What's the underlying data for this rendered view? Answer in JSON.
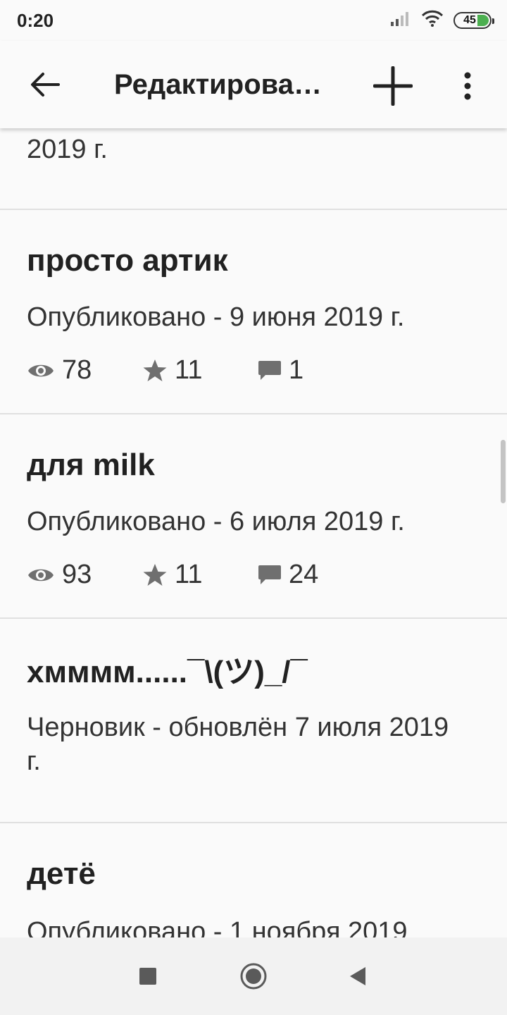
{
  "status_bar": {
    "time": "0:20",
    "battery": "45"
  },
  "app_bar": {
    "title": "Редактирова…"
  },
  "posts": [
    {
      "status": "2019 г."
    },
    {
      "title": "просто артик",
      "status": "Опубликовано - 9 июня 2019 г.",
      "views": "78",
      "stars": "11",
      "comments": "1"
    },
    {
      "title": "для milk",
      "status": "Опубликовано - 6 июля 2019 г.",
      "views": "93",
      "stars": "11",
      "comments": "24"
    },
    {
      "title": "хмммм......¯\\(ツ)_/¯",
      "status": "Черновик - обновлён 7 июля 2019 г."
    },
    {
      "title": "детё",
      "status": "Опубликовано - 1 ноября 2019"
    }
  ],
  "colors": {
    "icon_gray": "#6f6f6f",
    "divider": "#e0e0e0",
    "battery_green": "#4caf50"
  }
}
